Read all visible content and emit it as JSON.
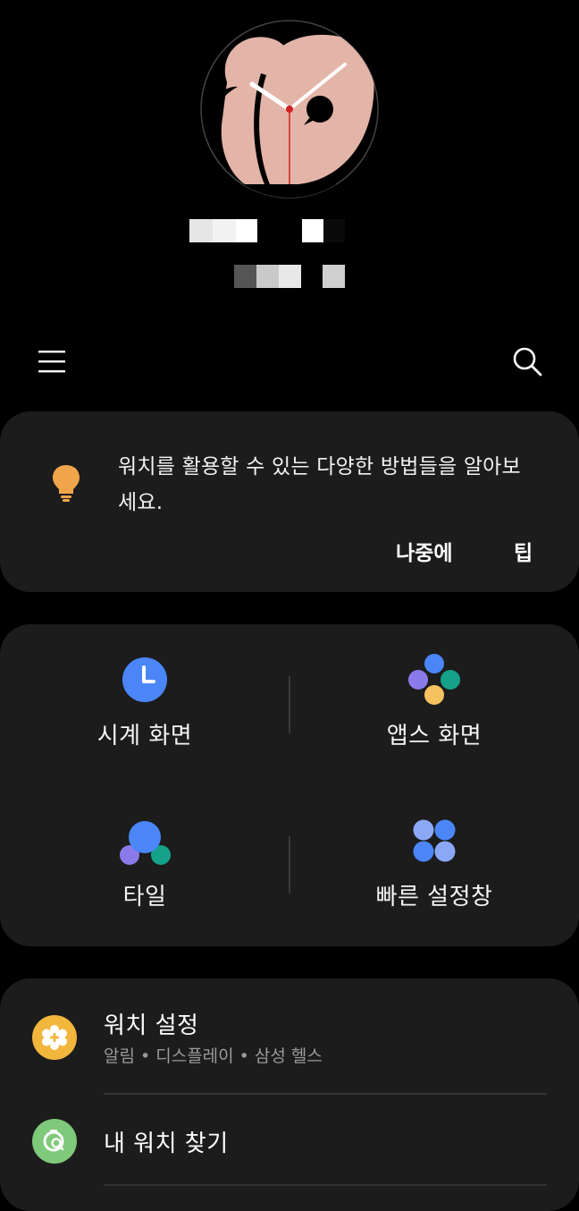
{
  "header": {
    "watch_face_name": "watch-face-preview",
    "device_name_obscured": true,
    "device_status_obscured": true
  },
  "toolbar": {
    "menu_icon": "hamburger-menu-icon",
    "search_icon": "search-icon"
  },
  "tip_card": {
    "icon": "lightbulb-icon",
    "message": "워치를 활용할 수 있는 다양한 방법들을 알아보세요.",
    "later_label": "나중에",
    "tips_label": "팁"
  },
  "grid": {
    "items": [
      {
        "label": "시계 화면",
        "icon": "clock-icon"
      },
      {
        "label": "앱스 화면",
        "icon": "apps-icon"
      },
      {
        "label": "타일",
        "icon": "tiles-icon"
      },
      {
        "label": "빠른 설정창",
        "icon": "quick-settings-icon"
      }
    ]
  },
  "settings_list": {
    "items": [
      {
        "title": "워치 설정",
        "subtitle": "알림 • 디스플레이 • 삼성 헬스",
        "icon": "gear-icon"
      },
      {
        "title": "내 워치 찾기",
        "subtitle": "",
        "icon": "find-watch-icon"
      }
    ]
  },
  "colors": {
    "background": "#000000",
    "card": "#1c1c1c",
    "accent_blue": "#4a86f7",
    "accent_purple": "#8b7bea",
    "accent_teal": "#16a28a",
    "accent_yellow": "#f5c25f",
    "settings_icon_bg": "#f2b63c",
    "find_icon_bg": "#7fc97a",
    "tip_icon": "#f0a54a"
  }
}
